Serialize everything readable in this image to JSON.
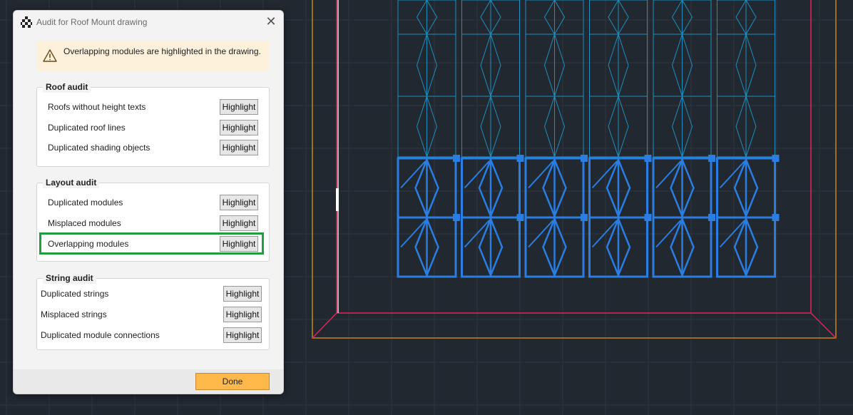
{
  "dialog": {
    "title": "Audit for Roof Mount drawing",
    "close_glyph": "✕",
    "app_icon": "checkered-app-icon",
    "warning": {
      "icon": "warning-triangle-icon",
      "text": "Overlapping modules are highlighted in the drawing."
    },
    "roof_audit": {
      "title": "Roof audit",
      "rows": [
        {
          "label": "Roofs without height texts",
          "button": "Highlight"
        },
        {
          "label": "Duplicated roof lines",
          "button": "Highlight"
        },
        {
          "label": "Duplicated shading objects",
          "button": "Highlight"
        }
      ]
    },
    "layout_audit": {
      "title": "Layout audit",
      "rows": [
        {
          "label": "Duplicated modules",
          "button": "Highlight"
        },
        {
          "label": "Misplaced modules",
          "button": "Highlight"
        },
        {
          "label": "Overlapping modules",
          "button": "Highlight",
          "focused": true
        }
      ]
    },
    "string_audit": {
      "title": "String audit",
      "rows": [
        {
          "label": "Duplicated strings",
          "button": "Highlight"
        },
        {
          "label": "Misplaced strings",
          "button": "Highlight"
        },
        {
          "label": "Duplicated module connections",
          "button": "Highlight"
        }
      ]
    },
    "done_label": "Done"
  },
  "drawing": {
    "background": "#212830",
    "grid_color": "#2e3641",
    "module_color": "#1e8fbf",
    "highlight_color": "#2a7de1",
    "roof_outline_color": "#e0245e",
    "boundary_color": "#c8841e",
    "columns": 6,
    "normal_rows": 3,
    "highlighted_rows": 2
  }
}
